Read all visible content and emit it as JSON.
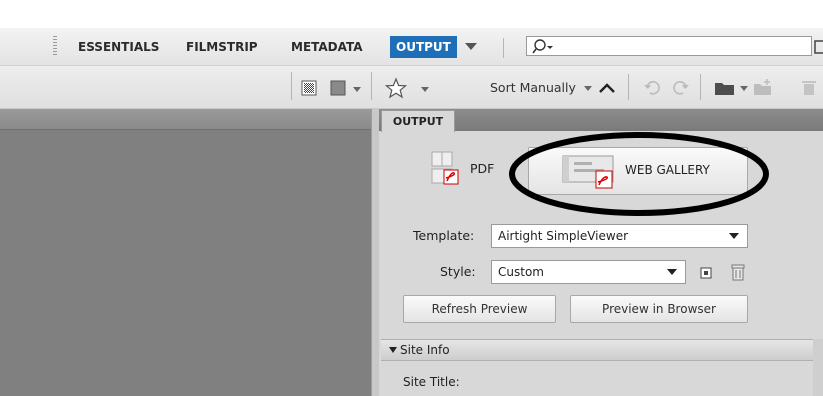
{
  "workspace_bar": {
    "tabs": [
      {
        "label": "ESSENTIALS"
      },
      {
        "label": "FILMSTRIP"
      },
      {
        "label": "METADATA"
      },
      {
        "label": "OUTPUT",
        "active": true
      }
    ],
    "search": {
      "placeholder": ""
    }
  },
  "toolbar2": {
    "sort_label": "Sort Manually"
  },
  "output_panel": {
    "tab_label": "OUTPUT",
    "pdf_label": "PDF",
    "web_gallery_label": "WEB GALLERY",
    "template_label": "Template:",
    "template_value": "Airtight SimpleViewer",
    "style_label": "Style:",
    "style_value": "Custom",
    "refresh_label": "Refresh Preview",
    "preview_browser_label": "Preview in Browser",
    "site_info_label": "Site Info",
    "site_title_label": "Site Title:"
  },
  "colors": {
    "active_tab": "#1f6fb8",
    "left_pane": "#808080",
    "panel_bg": "#d8d8d8"
  }
}
